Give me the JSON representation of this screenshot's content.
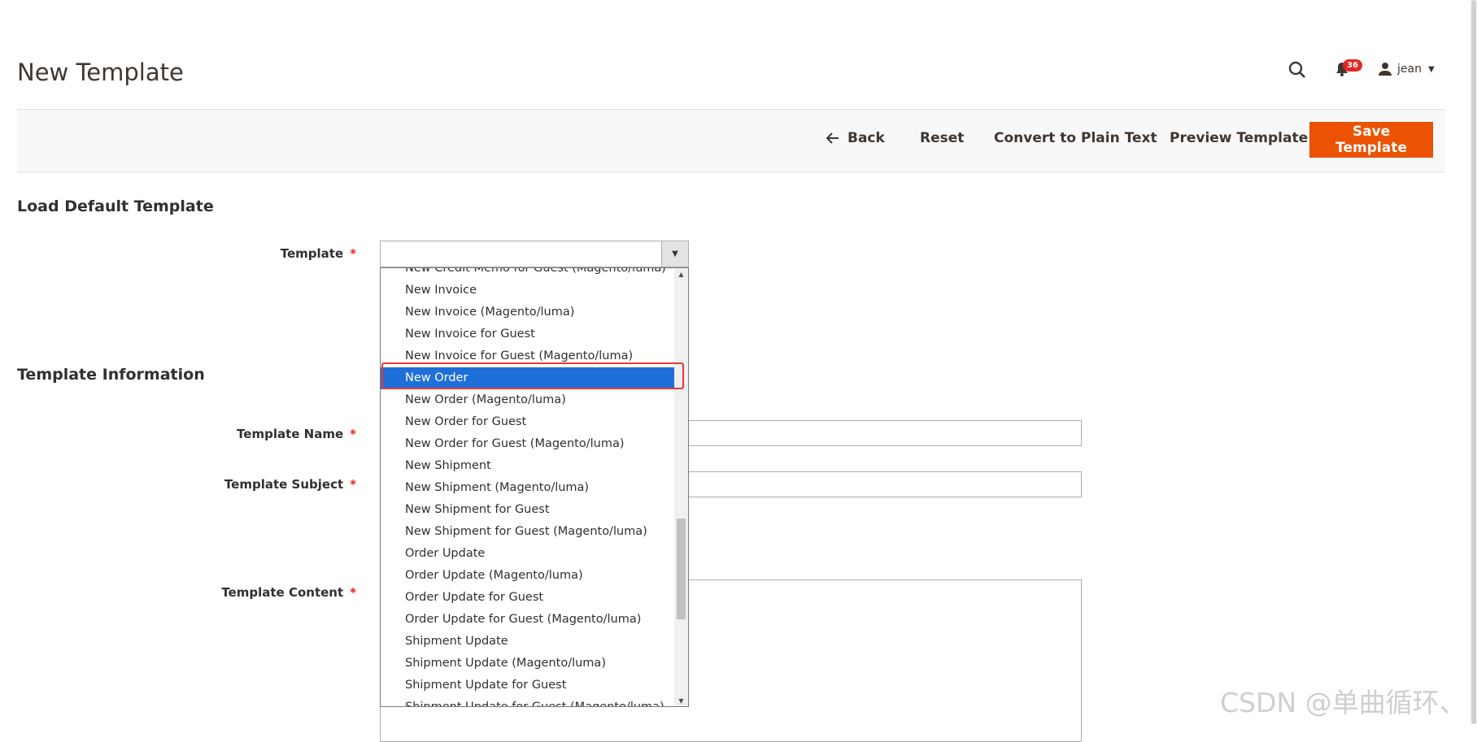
{
  "page": {
    "title": "New Template"
  },
  "header": {
    "notifications_count": "36",
    "user_name": "jean"
  },
  "actions": {
    "back": "Back",
    "reset": "Reset",
    "convert": "Convert to Plain Text",
    "preview": "Preview Template",
    "save": "Save Template"
  },
  "sections": {
    "load_default": "Load Default Template",
    "template_info": "Template Information"
  },
  "fields": {
    "template": {
      "label": "Template",
      "required_mark": "*",
      "value": ""
    },
    "template_name": {
      "label": "Template Name",
      "required_mark": "*",
      "value": ""
    },
    "template_subject": {
      "label": "Template Subject",
      "required_mark": "*",
      "value": ""
    },
    "template_content": {
      "label": "Template Content",
      "required_mark": "*",
      "value": ""
    }
  },
  "dropdown": {
    "selected_index": 5,
    "items": [
      "New Credit Memo for Guest (Magento/luma)",
      "New Invoice",
      "New Invoice (Magento/luma)",
      "New Invoice for Guest",
      "New Invoice for Guest (Magento/luma)",
      "New Order",
      "New Order (Magento/luma)",
      "New Order for Guest",
      "New Order for Guest (Magento/luma)",
      "New Shipment",
      "New Shipment (Magento/luma)",
      "New Shipment for Guest",
      "New Shipment for Guest (Magento/luma)",
      "Order Update",
      "Order Update (Magento/luma)",
      "Order Update for Guest",
      "Order Update for Guest (Magento/luma)",
      "Shipment Update",
      "Shipment Update (Magento/luma)",
      "Shipment Update for Guest",
      "Shipment Update for Guest (Magento/luma)"
    ]
  },
  "watermark": "CSDN @单曲循环、",
  "colors": {
    "accent": "#eb5202",
    "selected": "#1e6fd9",
    "required": "#e22626"
  }
}
